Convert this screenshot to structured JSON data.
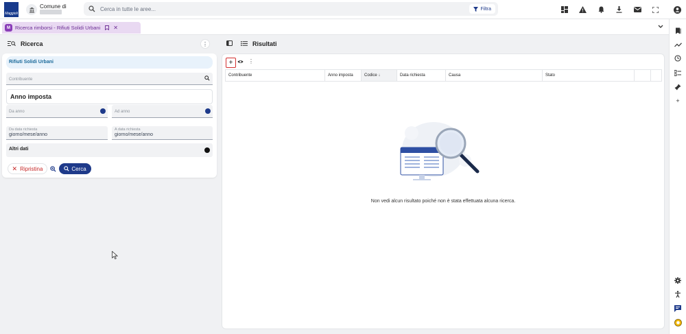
{
  "header": {
    "logo_text": "Maggioli",
    "comune_label": "Comune di",
    "search_placeholder": "Cerca in tutte le aree...",
    "filter_label": "Filtra",
    "icons": [
      "apps-icon",
      "warning-icon",
      "bell-icon",
      "download-icon",
      "mail-icon",
      "fullscreen-icon",
      "account-icon"
    ]
  },
  "tabs": [
    {
      "badge": "M",
      "title": "Ricerca rimborsi - Rifiuti Solidi Urbani",
      "active": true
    }
  ],
  "search_panel": {
    "title": "Ricerca",
    "tributo": "Rifiuti Solidi Urbani",
    "contribuente_placeholder": "Contribuente",
    "section_title": "Anno imposta",
    "da_anno_placeholder": "Da anno",
    "ad_anno_placeholder": "Ad anno",
    "da_data_label": "Da data richiesta",
    "da_data_value": "giorno/mese/anno",
    "a_data_label": "A data richiesta",
    "a_data_value": "giorno/mese/anno",
    "altri_dati_label": "Altri dati",
    "reset_label": "Ripristina",
    "search_label": "Cerca"
  },
  "results_panel": {
    "title": "Risultati",
    "columns": [
      "Contribuente",
      "Anno imposta",
      "Codice",
      "Data richiesta",
      "Causa",
      "Stato"
    ],
    "sorted_column": "Codice",
    "sort_indicator": "↓",
    "empty_message": "Non vedi alcun risultato poiché non è stata effettuata alcuna ricerca."
  },
  "rail": {
    "icons": [
      "bookmarks-icon",
      "trending-icon",
      "history-icon",
      "checklist-icon",
      "pin-icon",
      "add-icon",
      "settings-icon",
      "accessibility-icon",
      "chat-icon",
      "support-icon"
    ]
  },
  "colors": {
    "primary": "#1e3a8a",
    "tab_bg": "#e9d9f2",
    "tab_text": "#6a2c93",
    "reset_red": "#c62828",
    "highlight_border": "#d32f2f"
  }
}
